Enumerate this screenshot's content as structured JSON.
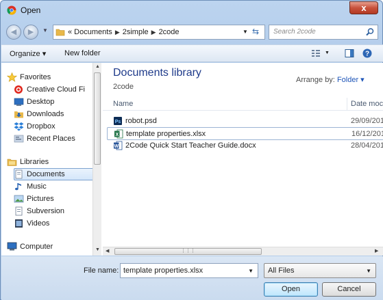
{
  "window": {
    "title": "Open",
    "close_label": "x"
  },
  "address": {
    "crumbs": [
      "« Documents",
      "2simple",
      "2code"
    ],
    "search_placeholder": "Search 2code"
  },
  "toolbar": {
    "organize": "Organize ▾",
    "new_folder": "New folder"
  },
  "nav_pane": {
    "items": [
      {
        "label": "Favorites",
        "icon": "star-icon"
      },
      {
        "label": "Creative Cloud Fi",
        "icon": "creative-cloud-icon"
      },
      {
        "label": "Desktop",
        "icon": "desktop-icon"
      },
      {
        "label": "Downloads",
        "icon": "downloads-icon"
      },
      {
        "label": "Dropbox",
        "icon": "dropbox-icon"
      },
      {
        "label": "Recent Places",
        "icon": "recent-places-icon"
      },
      {
        "label": "Libraries",
        "icon": "libraries-icon"
      },
      {
        "label": "Documents",
        "icon": "documents-icon"
      },
      {
        "label": "Music",
        "icon": "music-icon"
      },
      {
        "label": "Pictures",
        "icon": "pictures-icon"
      },
      {
        "label": "Subversion",
        "icon": "subversion-icon"
      },
      {
        "label": "Videos",
        "icon": "videos-icon"
      },
      {
        "label": "Computer",
        "icon": "computer-icon"
      }
    ],
    "selected": "Documents"
  },
  "library": {
    "title": "Documents library",
    "subtitle": "2code",
    "arrange_label": "Arrange by:",
    "arrange_value": "Folder ▾"
  },
  "columns": {
    "name": "Name",
    "date": "Date moc"
  },
  "files": [
    {
      "name": "robot.psd",
      "date": "29/09/201",
      "icon": "photoshop-file-icon"
    },
    {
      "name": "template properties.xlsx",
      "date": "16/12/201",
      "icon": "excel-file-icon"
    },
    {
      "name": "2Code Quick Start Teacher Guide.docx",
      "date": "28/04/201",
      "icon": "word-file-icon"
    }
  ],
  "selected_file": "template properties.xlsx",
  "bottom": {
    "filename_label": "File name:",
    "filename_value": "template properties.xlsx",
    "filetype_value": "All Files",
    "open_label": "Open",
    "cancel_label": "Cancel"
  },
  "colors": {
    "accent": "#1e3a8a",
    "selection_border": "#7da2ce",
    "link": "#1e55b8"
  }
}
